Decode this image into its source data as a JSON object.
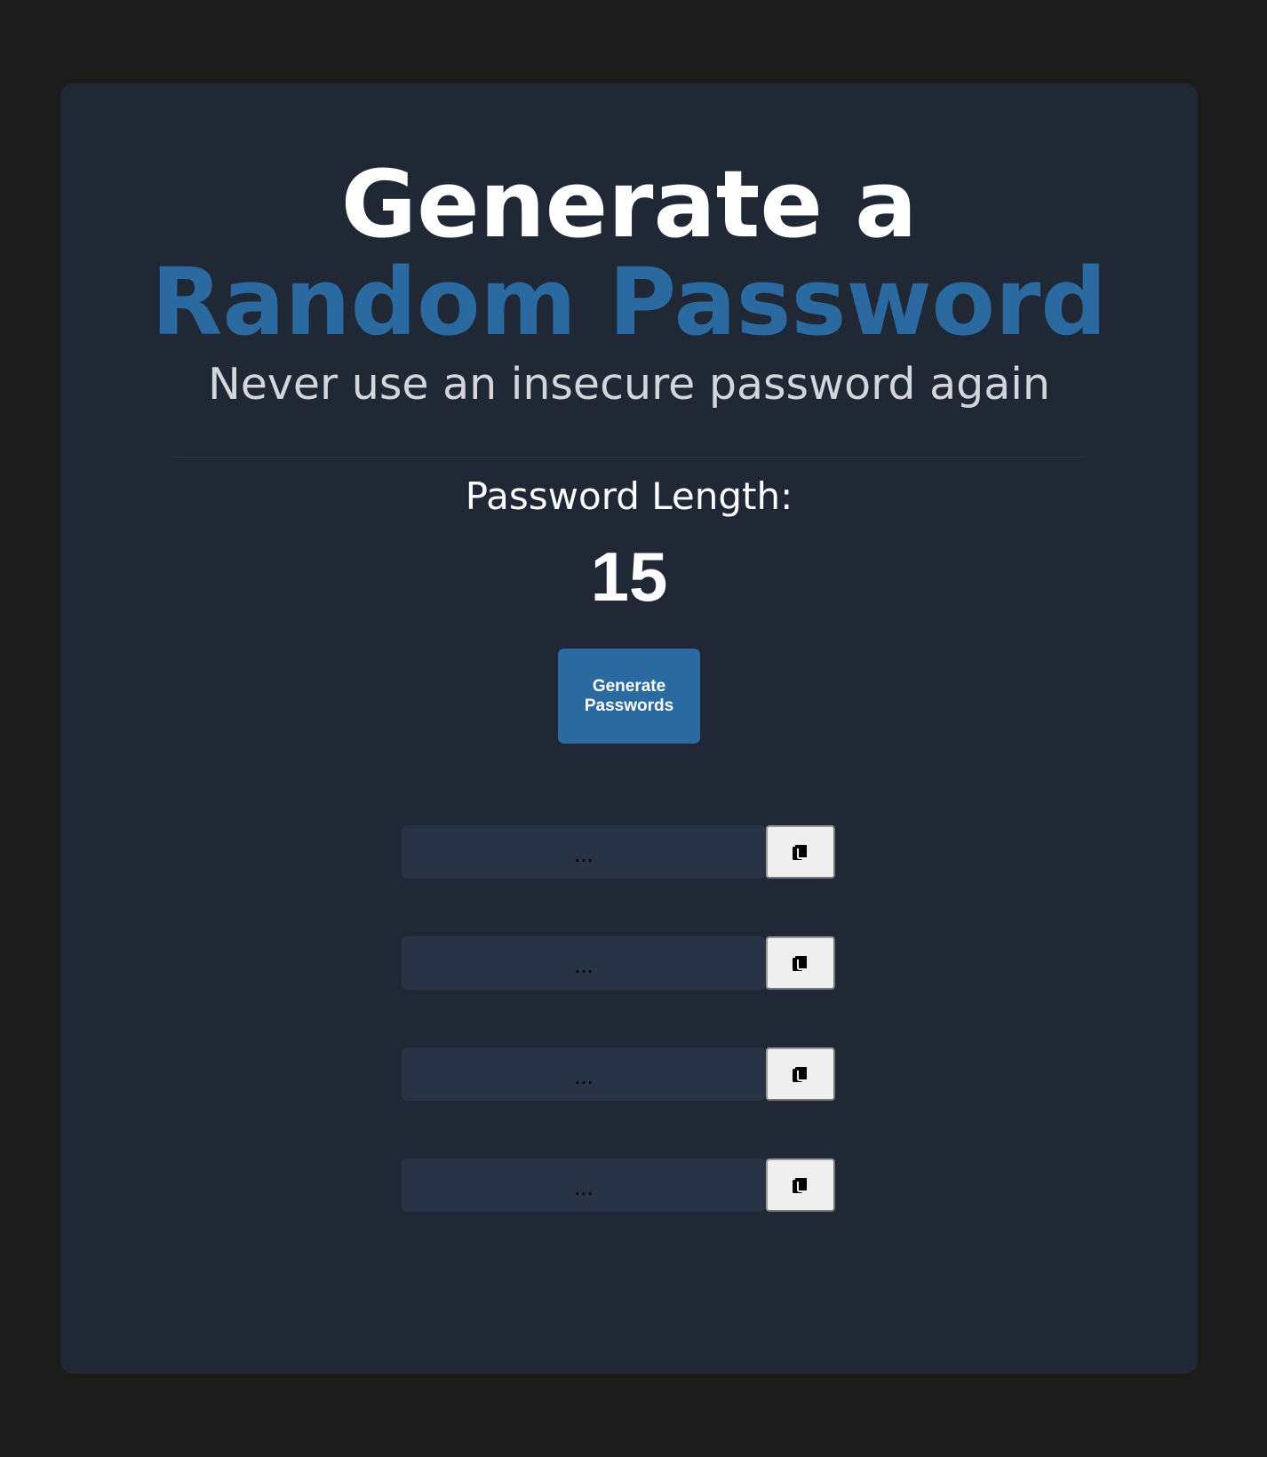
{
  "header": {
    "title_line1": "Generate a",
    "title_line2": "Random Password",
    "subtitle": "Never use an insecure password again"
  },
  "colors": {
    "page_background": "#1c1c1c",
    "card_background": "#202835",
    "accent": "#2b6aa1",
    "field_background": "#283446"
  },
  "length": {
    "label": "Password Length:",
    "value": "15"
  },
  "generate_button": {
    "label": "Generate Passwords"
  },
  "passwords": [
    {
      "value": "...",
      "copy_icon": "clipboard-icon"
    },
    {
      "value": "...",
      "copy_icon": "clipboard-icon"
    },
    {
      "value": "...",
      "copy_icon": "clipboard-icon"
    },
    {
      "value": "...",
      "copy_icon": "clipboard-icon"
    }
  ]
}
